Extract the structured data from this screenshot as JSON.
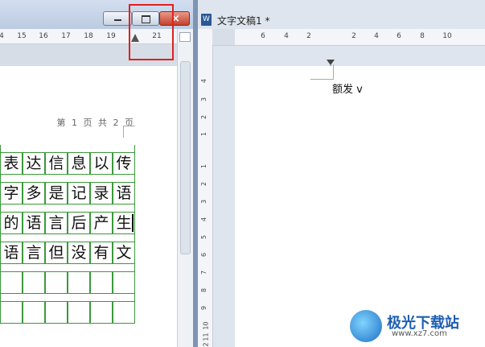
{
  "left_window": {
    "ruler_ticks": [
      "4",
      "15",
      "16",
      "17",
      "18",
      "19",
      "21"
    ],
    "page_info": "第 1 页 共 2 页",
    "grid_rows": [
      [
        "表",
        "达",
        "信",
        "息",
        "以",
        "传"
      ],
      [
        "字",
        "多",
        "是",
        "记",
        "录",
        "语"
      ],
      [
        "的",
        "语",
        "言",
        "后",
        "产",
        "生"
      ],
      [
        "语",
        "言",
        "但",
        "没",
        "有",
        "文"
      ],
      [
        "",
        "",
        "",
        "",
        "",
        ""
      ],
      [
        "",
        "",
        "",
        "",
        "",
        ""
      ]
    ]
  },
  "right_window": {
    "title": "文字文稿1 *",
    "doc_icon": "W",
    "ruler_ticks": [
      "6",
      "4",
      "2",
      "2",
      "4",
      "6",
      "8",
      "10"
    ],
    "vruler_ticks": [
      "4",
      "3",
      "2",
      "1",
      "1",
      "2",
      "3",
      "4",
      "5",
      "6",
      "7",
      "8",
      "9",
      "10",
      "11",
      "12"
    ],
    "doc_text": "额发 v"
  },
  "watermark": {
    "name": "极光下载站",
    "url": "www.xz7.com"
  },
  "colors": {
    "highlight": "#e02020",
    "grid": "#3a9a3a",
    "close_button": "#c4402a"
  }
}
